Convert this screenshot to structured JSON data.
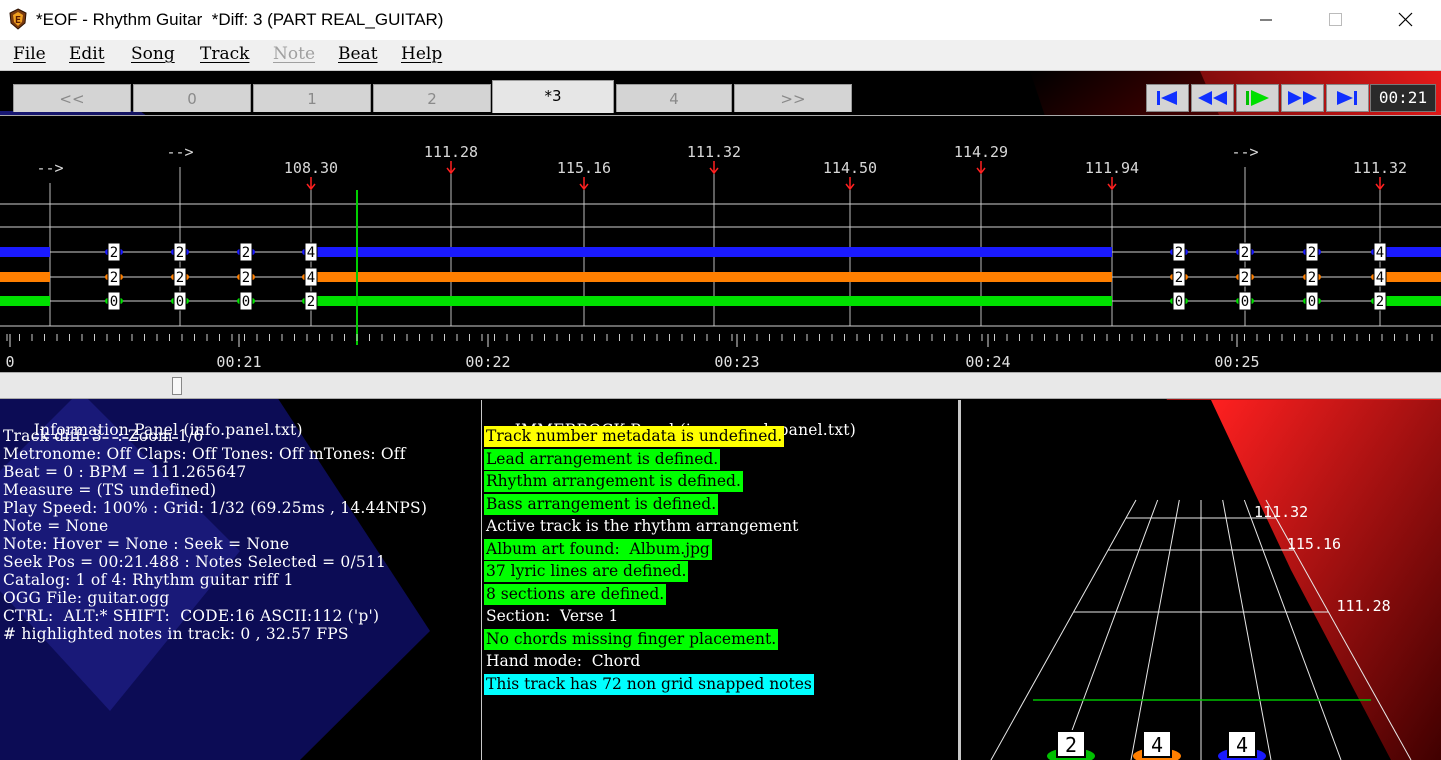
{
  "window": {
    "title": "*EOF - Rhythm Guitar  *Diff: 3 (PART REAL_GUITAR)"
  },
  "menu": [
    {
      "label": "File",
      "disabled": false
    },
    {
      "label": "Edit",
      "disabled": false
    },
    {
      "label": "Song",
      "disabled": false
    },
    {
      "label": "Track",
      "disabled": false
    },
    {
      "label": "Note",
      "disabled": true
    },
    {
      "label": "Beat",
      "disabled": false
    },
    {
      "label": "Help",
      "disabled": false
    }
  ],
  "tabs": [
    "<<",
    "0",
    "1",
    "2",
    "*3",
    "4",
    ">>"
  ],
  "active_tab": "*3",
  "transport": {
    "buttons": [
      "skip-to-start",
      "rewind",
      "play",
      "fast-forward",
      "skip-to-end"
    ],
    "time": "00:21"
  },
  "editor": {
    "beat_labels": [
      {
        "text": "-->",
        "row": 1
      },
      {
        "text": "-->",
        "row": 0
      },
      {
        "text": "108.30",
        "row": 1
      },
      {
        "text": "111.28",
        "row": 0
      },
      {
        "text": "115.16",
        "row": 1
      },
      {
        "text": "111.32",
        "row": 0
      },
      {
        "text": "114.50",
        "row": 1
      },
      {
        "text": "114.29",
        "row": 0
      },
      {
        "text": "111.94",
        "row": 1
      },
      {
        "text": "-->",
        "row": 0
      },
      {
        "text": "111.32",
        "row": 1
      }
    ],
    "note_groups": [
      {
        "frets": [
          "2",
          "2",
          "0"
        ]
      },
      {
        "frets": [
          "2",
          "2",
          "0"
        ]
      },
      {
        "frets": [
          "2",
          "2",
          "0"
        ]
      },
      {
        "frets": [
          "4",
          "4",
          "2"
        ]
      },
      {
        "frets": [
          "2",
          "2",
          "0"
        ]
      },
      {
        "frets": [
          "2",
          "2",
          "0"
        ]
      },
      {
        "frets": [
          "2",
          "2",
          "0"
        ]
      },
      {
        "frets": [
          "4",
          "4",
          "2"
        ]
      }
    ],
    "string_colors": [
      "#1a1aff",
      "#ff7f00",
      "#00e000"
    ],
    "timeline_labels": [
      "0",
      "00:21",
      "00:22",
      "00:23",
      "00:24",
      "00:25"
    ]
  },
  "info_panel": {
    "title": "Information Panel",
    "file": " (info.panel.txt)",
    "lines": [
      "Track diff: 3   : Zoom 1/6",
      "Metronome: Off Claps: Off Tones: Off mTones: Off",
      "Beat = 0 : BPM = 111.265647",
      "Measure = (TS undefined)",
      "Play Speed: 100% : Grid: 1/32 (69.25ms , 14.44NPS)",
      "Note = None",
      "Note: Hover = None : Seek = None",
      "Seek Pos = 00:21.488 : Notes Selected = 0/511",
      "Catalog: 1 of 4: Rhythm guitar riff 1",
      "OGG File: guitar.ogg",
      "CTRL:  ALT:* SHIFT:  CODE:16 ASCII:112 ('p')",
      "# highlighted notes in track: 0 , 32.57 FPS"
    ]
  },
  "immerrock_panel": {
    "title": "IMMERROCK Panel",
    "file": " (immerrock.panel.txt)",
    "lines": [
      {
        "text": "Track number metadata is undefined.",
        "bg": "#ffff00"
      },
      {
        "text": "Lead arrangement is defined.",
        "bg": "#00ff00"
      },
      {
        "text": "Rhythm arrangement is defined.",
        "bg": "#00ff00"
      },
      {
        "text": "Bass arrangement is defined.",
        "bg": "#00ff00"
      },
      {
        "text": "Active track is the rhythm arrangement",
        "bg": ""
      },
      {
        "text": "Album art found:  Album.jpg",
        "bg": "#00ff00"
      },
      {
        "text": "37 lyric lines are defined.",
        "bg": "#00ff00"
      },
      {
        "text": "8 sections are defined.",
        "bg": "#00ff00"
      },
      {
        "text": "Section:  Verse 1",
        "bg": ""
      },
      {
        "text": "No chords missing finger placement.",
        "bg": "#00ff00"
      },
      {
        "text": "Hand mode:  Chord",
        "bg": ""
      },
      {
        "text": "This track has 72 non grid snapped notes",
        "bg": "#00ffff"
      }
    ]
  },
  "preview_3d": {
    "beat_labels": [
      "111.32",
      "115.16",
      "111.28"
    ],
    "notes": [
      "2",
      "4",
      "4"
    ]
  }
}
